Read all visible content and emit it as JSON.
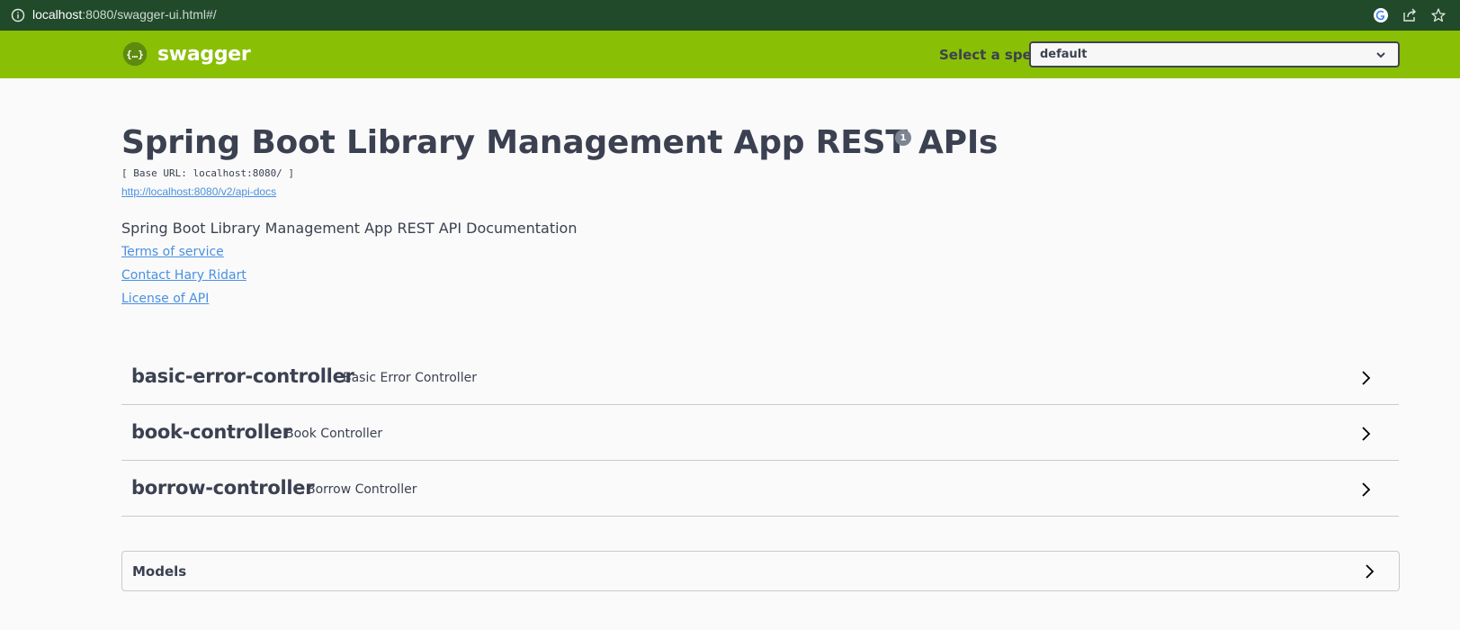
{
  "browser": {
    "url_host": "localhost",
    "url_rest": ":8080/swagger-ui.html#/",
    "icons": [
      "info-icon",
      "google-icon",
      "share-icon",
      "star-icon"
    ]
  },
  "topbar": {
    "brand": "swagger",
    "spec_label": "Select a spec",
    "spec_selected": "default",
    "colors": {
      "background": "#89bf04",
      "text": "#ffffff"
    }
  },
  "info": {
    "title": "Spring Boot Library Management App REST APIs",
    "version_badge": "1",
    "base_url": "[ Base URL: localhost:8080/ ]",
    "api_docs_link": "http://localhost:8080/v2/api-docs",
    "description": "Spring Boot Library Management App REST API Documentation",
    "links": {
      "terms": "Terms of service",
      "contact": "Contact Hary Ridart",
      "license": "License of API"
    }
  },
  "tags": [
    {
      "name": "basic-error-controller",
      "description": "Basic Error Controller"
    },
    {
      "name": "book-controller",
      "description": "Book Controller"
    },
    {
      "name": "borrow-controller",
      "description": "Borrow Controller"
    }
  ],
  "models": {
    "label": "Models"
  }
}
